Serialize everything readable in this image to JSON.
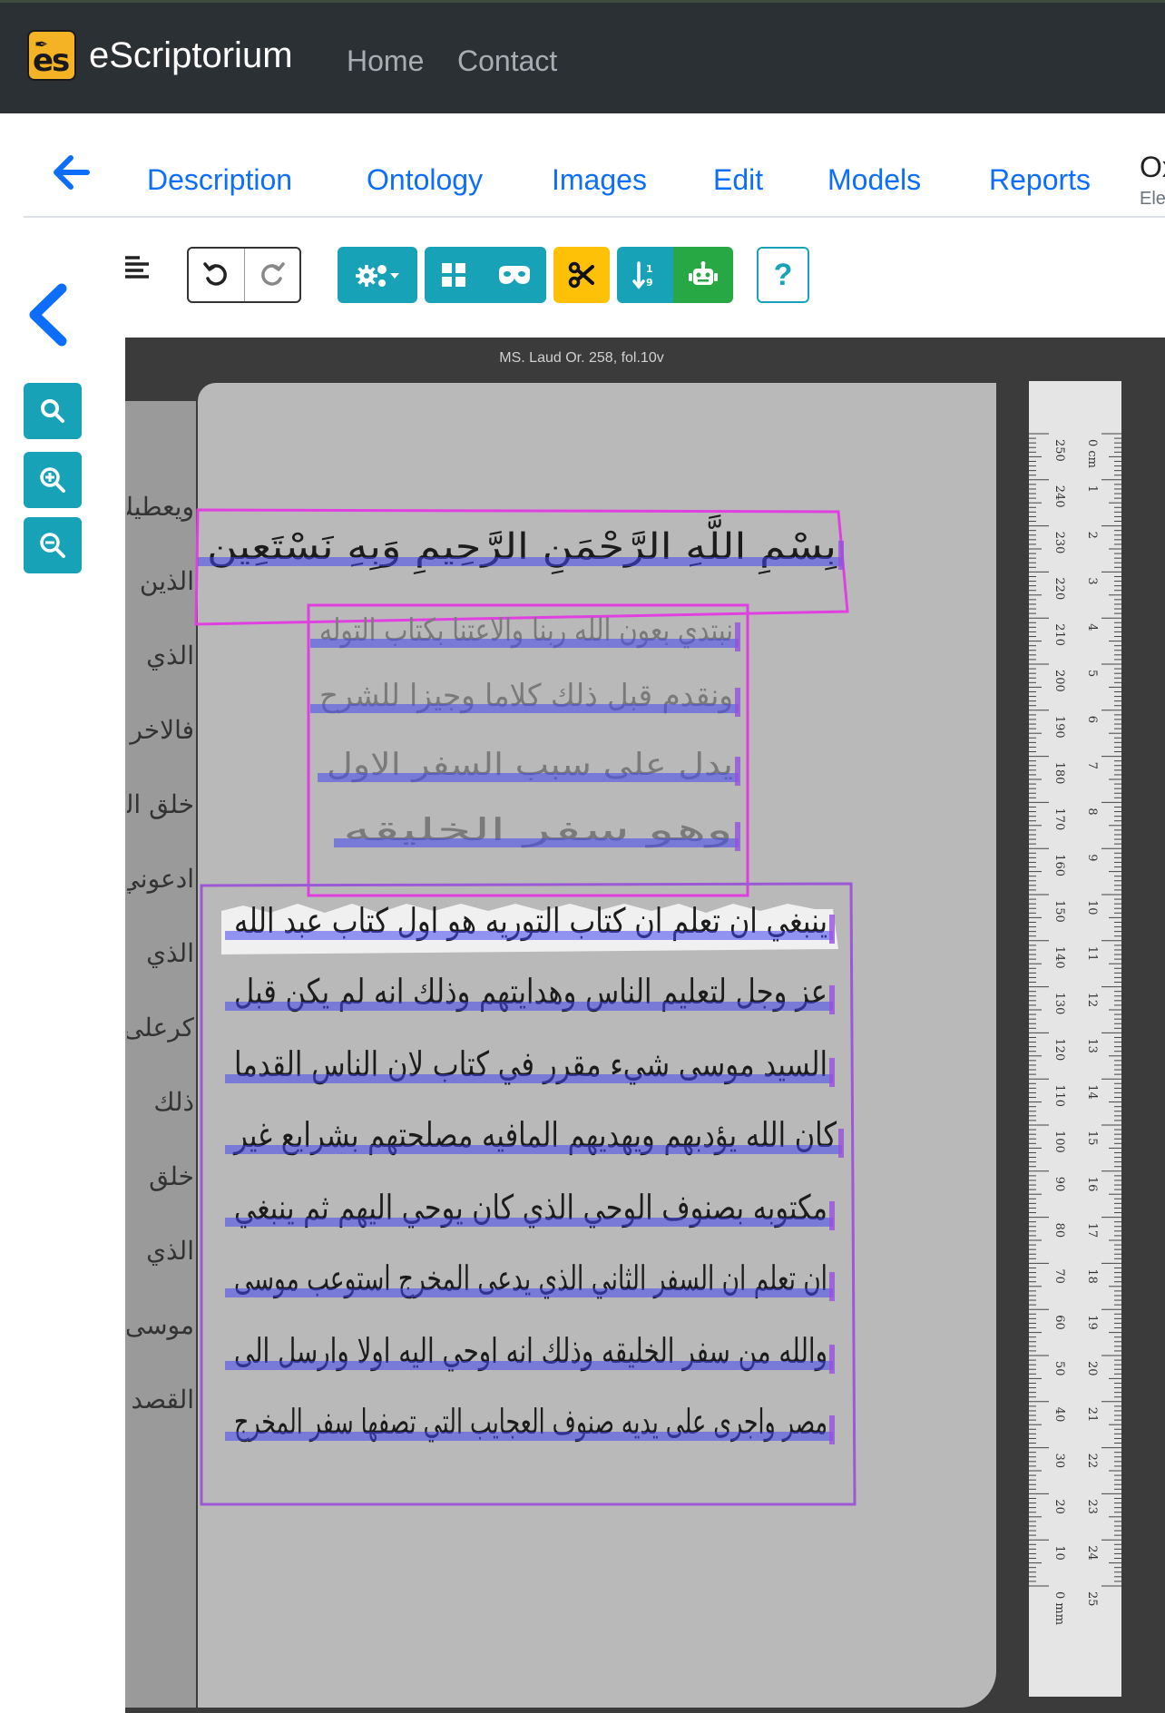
{
  "app": {
    "name": "eScriptorium",
    "nav": {
      "home": "Home",
      "contact": "Contact"
    }
  },
  "tabs": {
    "items": [
      "Description",
      "Ontology",
      "Images",
      "Edit",
      "Models",
      "Reports"
    ],
    "document_title": "Ox",
    "document_subtitle": "Ele"
  },
  "viewer": {
    "caption": "MS. Laud Or. 258, fol.10v",
    "lines": [
      "بِسْمِ اللَّهِ الرَّحْمَنِ الرَّحِيمِ وَبِهِ نَسْتَعِين",
      "نبتدي بعون الله ربنا والاعتنا بكتاب التوله",
      "ونقدم قبل ذلك كلاما وجيزا للشرح",
      "يدل على سبب السفر الاول",
      "وهو سفر الخليقه",
      "ينبغي ان تعلم ان كتاب التوريه هو اول كتاب عبد الله",
      "عز وجل لتعليم الناس وهدايتهم وذلك انه لم يكن قبل",
      "السيد موسى شيء مقرر في كتاب لان الناس القدما",
      "كان الله يؤدبهم ويهديهم المافيه مصلحتهم بشرايع غير",
      "مكتوبه بصنوف الوحي الذي كان يوحي اليهم ثم ينبغي",
      "ان تعلم ان السفر الثاني الذي يدعى المخرج استوعب موسى",
      "والله من سفر الخليقه وذلك انه اوحي اليه اولا وارسل الى",
      "مصر واجرى على يديه صنوف العجايب التي تصفها سفر المخرج"
    ],
    "margin": [
      "ويعطيك",
      "الذين",
      "الذي",
      "فالاخر",
      "خلق الله",
      "ادعوني",
      "الذي",
      "كرعلى",
      "ذلك",
      "خلق",
      "الذي",
      "موسى",
      "القصد"
    ],
    "ruler_cm": [
      "0 cm",
      "1",
      "2",
      "3",
      "4",
      "5",
      "6",
      "7",
      "8",
      "9",
      "10",
      "11",
      "12",
      "13",
      "14",
      "15",
      "16",
      "17",
      "18",
      "19",
      "20",
      "21",
      "22",
      "23",
      "24",
      "25"
    ],
    "ruler_mm": [
      "250",
      "240",
      "230",
      "220",
      "210",
      "200",
      "190",
      "180",
      "170",
      "160",
      "150",
      "140",
      "130",
      "120",
      "110",
      "100",
      "90",
      "80",
      "70",
      "60",
      "50",
      "40",
      "30",
      "20",
      "10",
      "0 mm"
    ]
  },
  "colors": {
    "navbar": "#2b3035",
    "link": "#0d6efd",
    "info": "#17a2b8",
    "warning": "#ffc107",
    "success": "#28a745",
    "region_title": "#e040e0",
    "region_main": "#9b59d6",
    "baseline": "#4646f0"
  },
  "icons": {
    "back": "arrow-left-icon",
    "collapse": "chevron-left-icon",
    "search": "search-icon",
    "zoom_in": "zoom-in-icon",
    "zoom_out": "zoom-out-icon",
    "panels": "hamburger-icon",
    "undo": "undo-icon",
    "redo": "redo-icon",
    "settings": "gears-icon",
    "regions": "grid-icon",
    "masks": "mask-icon",
    "cut": "scissors-icon",
    "reorder": "sort-icon",
    "transcribe": "robot-icon",
    "help": "question-icon"
  }
}
